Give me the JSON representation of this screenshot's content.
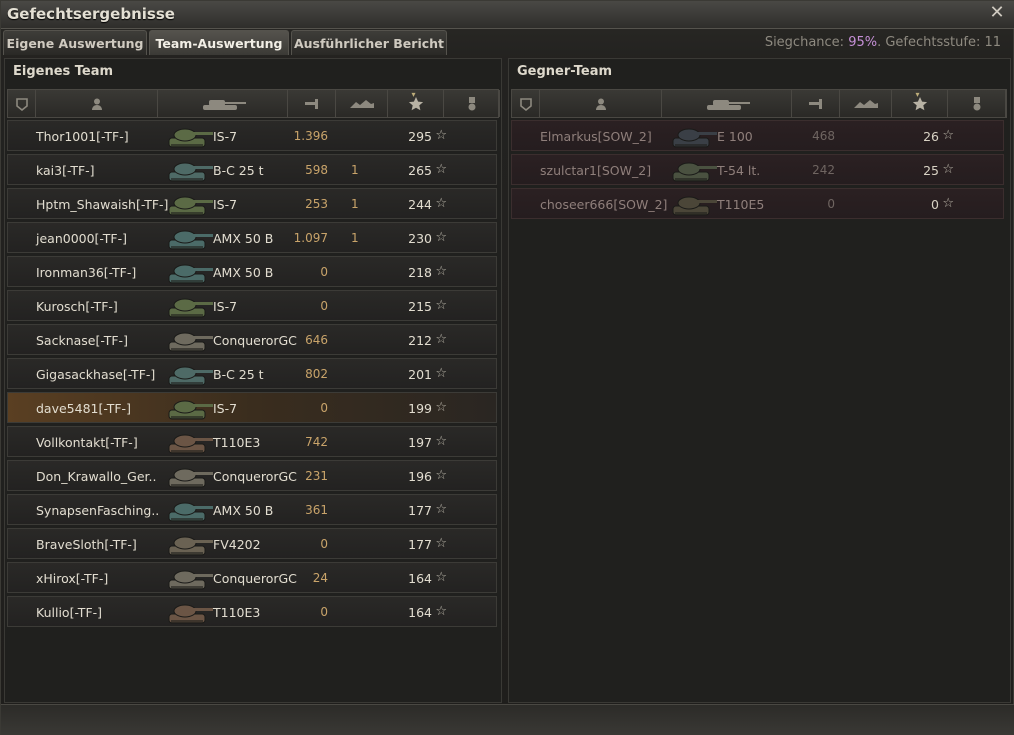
{
  "window": {
    "title": "Gefechtsergebnisse"
  },
  "tabs": [
    {
      "label": "Eigene Auswertung",
      "active": false
    },
    {
      "label": "Team-Auswertung",
      "active": true
    },
    {
      "label": "Ausführlicher Bericht",
      "active": false
    }
  ],
  "status": {
    "win_label": "Siegchance: ",
    "win_value": "95%",
    "tier_label": ". Gefechtsstufe: 11"
  },
  "own_team": {
    "title": "Eigenes Team",
    "rows": [
      {
        "player": "Thor1001[-TF-]",
        "tank": "IS-7",
        "tank_color": "#5b6a45",
        "damage": "1.396",
        "kills": "",
        "xp": "295"
      },
      {
        "player": "kai3[-TF-]",
        "tank": "B-C 25 t",
        "tank_color": "#4e6a66",
        "damage": "598",
        "kills": "1",
        "xp": "265"
      },
      {
        "player": "Hptm_Shawaish[-TF-]",
        "tank": "IS-7",
        "tank_color": "#5b6a45",
        "damage": "253",
        "kills": "1",
        "xp": "244"
      },
      {
        "player": "jean0000[-TF-]",
        "tank": "AMX 50 B",
        "tank_color": "#4b6b68",
        "damage": "1.097",
        "kills": "1",
        "xp": "230"
      },
      {
        "player": "Ironman36[-TF-]",
        "tank": "AMX 50 B",
        "tank_color": "#4b6b68",
        "damage": "0",
        "kills": "",
        "xp": "218"
      },
      {
        "player": "Kurosch[-TF-]",
        "tank": "IS-7",
        "tank_color": "#5b6a45",
        "damage": "0",
        "kills": "",
        "xp": "215"
      },
      {
        "player": "Sacknase[-TF-]",
        "tank": "ConquerorGC",
        "tank_color": "#6e6a5e",
        "damage": "646",
        "kills": "",
        "xp": "212"
      },
      {
        "player": "Gigasackhase[-TF-]",
        "tank": "B-C 25 t",
        "tank_color": "#4e6a66",
        "damage": "802",
        "kills": "",
        "xp": "201"
      },
      {
        "player": "dave5481[-TF-]",
        "tank": "IS-7",
        "tank_color": "#5b6a45",
        "damage": "0",
        "kills": "",
        "xp": "199",
        "highlight": true
      },
      {
        "player": "Vollkontakt[-TF-]",
        "tank": "T110E3",
        "tank_color": "#6b5545",
        "damage": "742",
        "kills": "",
        "xp": "197"
      },
      {
        "player": "Don_Krawallo_Ger..",
        "tank": "ConquerorGC",
        "tank_color": "#6e6a5e",
        "damage": "231",
        "kills": "",
        "xp": "196"
      },
      {
        "player": "SynapsenFasching..",
        "tank": "AMX 50 B",
        "tank_color": "#4b6b68",
        "damage": "361",
        "kills": "",
        "xp": "177"
      },
      {
        "player": "BraveSloth[-TF-]",
        "tank": "FV4202",
        "tank_color": "#6a6253",
        "damage": "0",
        "kills": "",
        "xp": "177"
      },
      {
        "player": "xHirox[-TF-]",
        "tank": "ConquerorGC",
        "tank_color": "#6e6a5e",
        "damage": "24",
        "kills": "",
        "xp": "164"
      },
      {
        "player": "Kullio[-TF-]",
        "tank": "T110E3",
        "tank_color": "#6b5545",
        "damage": "0",
        "kills": "",
        "xp": "164"
      }
    ]
  },
  "enemy_team": {
    "title": "Gegner-Team",
    "rows": [
      {
        "player": "Elmarkus[SOW_2]",
        "tank": "E 100",
        "tank_color": "#3a3f46",
        "damage": "468",
        "kills": "",
        "xp": "26"
      },
      {
        "player": "szulctar1[SOW_2]",
        "tank": "T-54 lt.",
        "tank_color": "#4a5140",
        "damage": "242",
        "kills": "",
        "xp": "25"
      },
      {
        "player": "choseer666[SOW_2]",
        "tank": "T110E5",
        "tank_color": "#4b4638",
        "damage": "0",
        "kills": "",
        "xp": "0"
      }
    ]
  },
  "columns": [
    {
      "name": "squad-icon"
    },
    {
      "name": "player-icon"
    },
    {
      "name": "tank-icon"
    },
    {
      "name": "damage-icon"
    },
    {
      "name": "frags-icon"
    },
    {
      "name": "xp-star-icon"
    },
    {
      "name": "medal-icon"
    }
  ],
  "star_glyph": "☆"
}
